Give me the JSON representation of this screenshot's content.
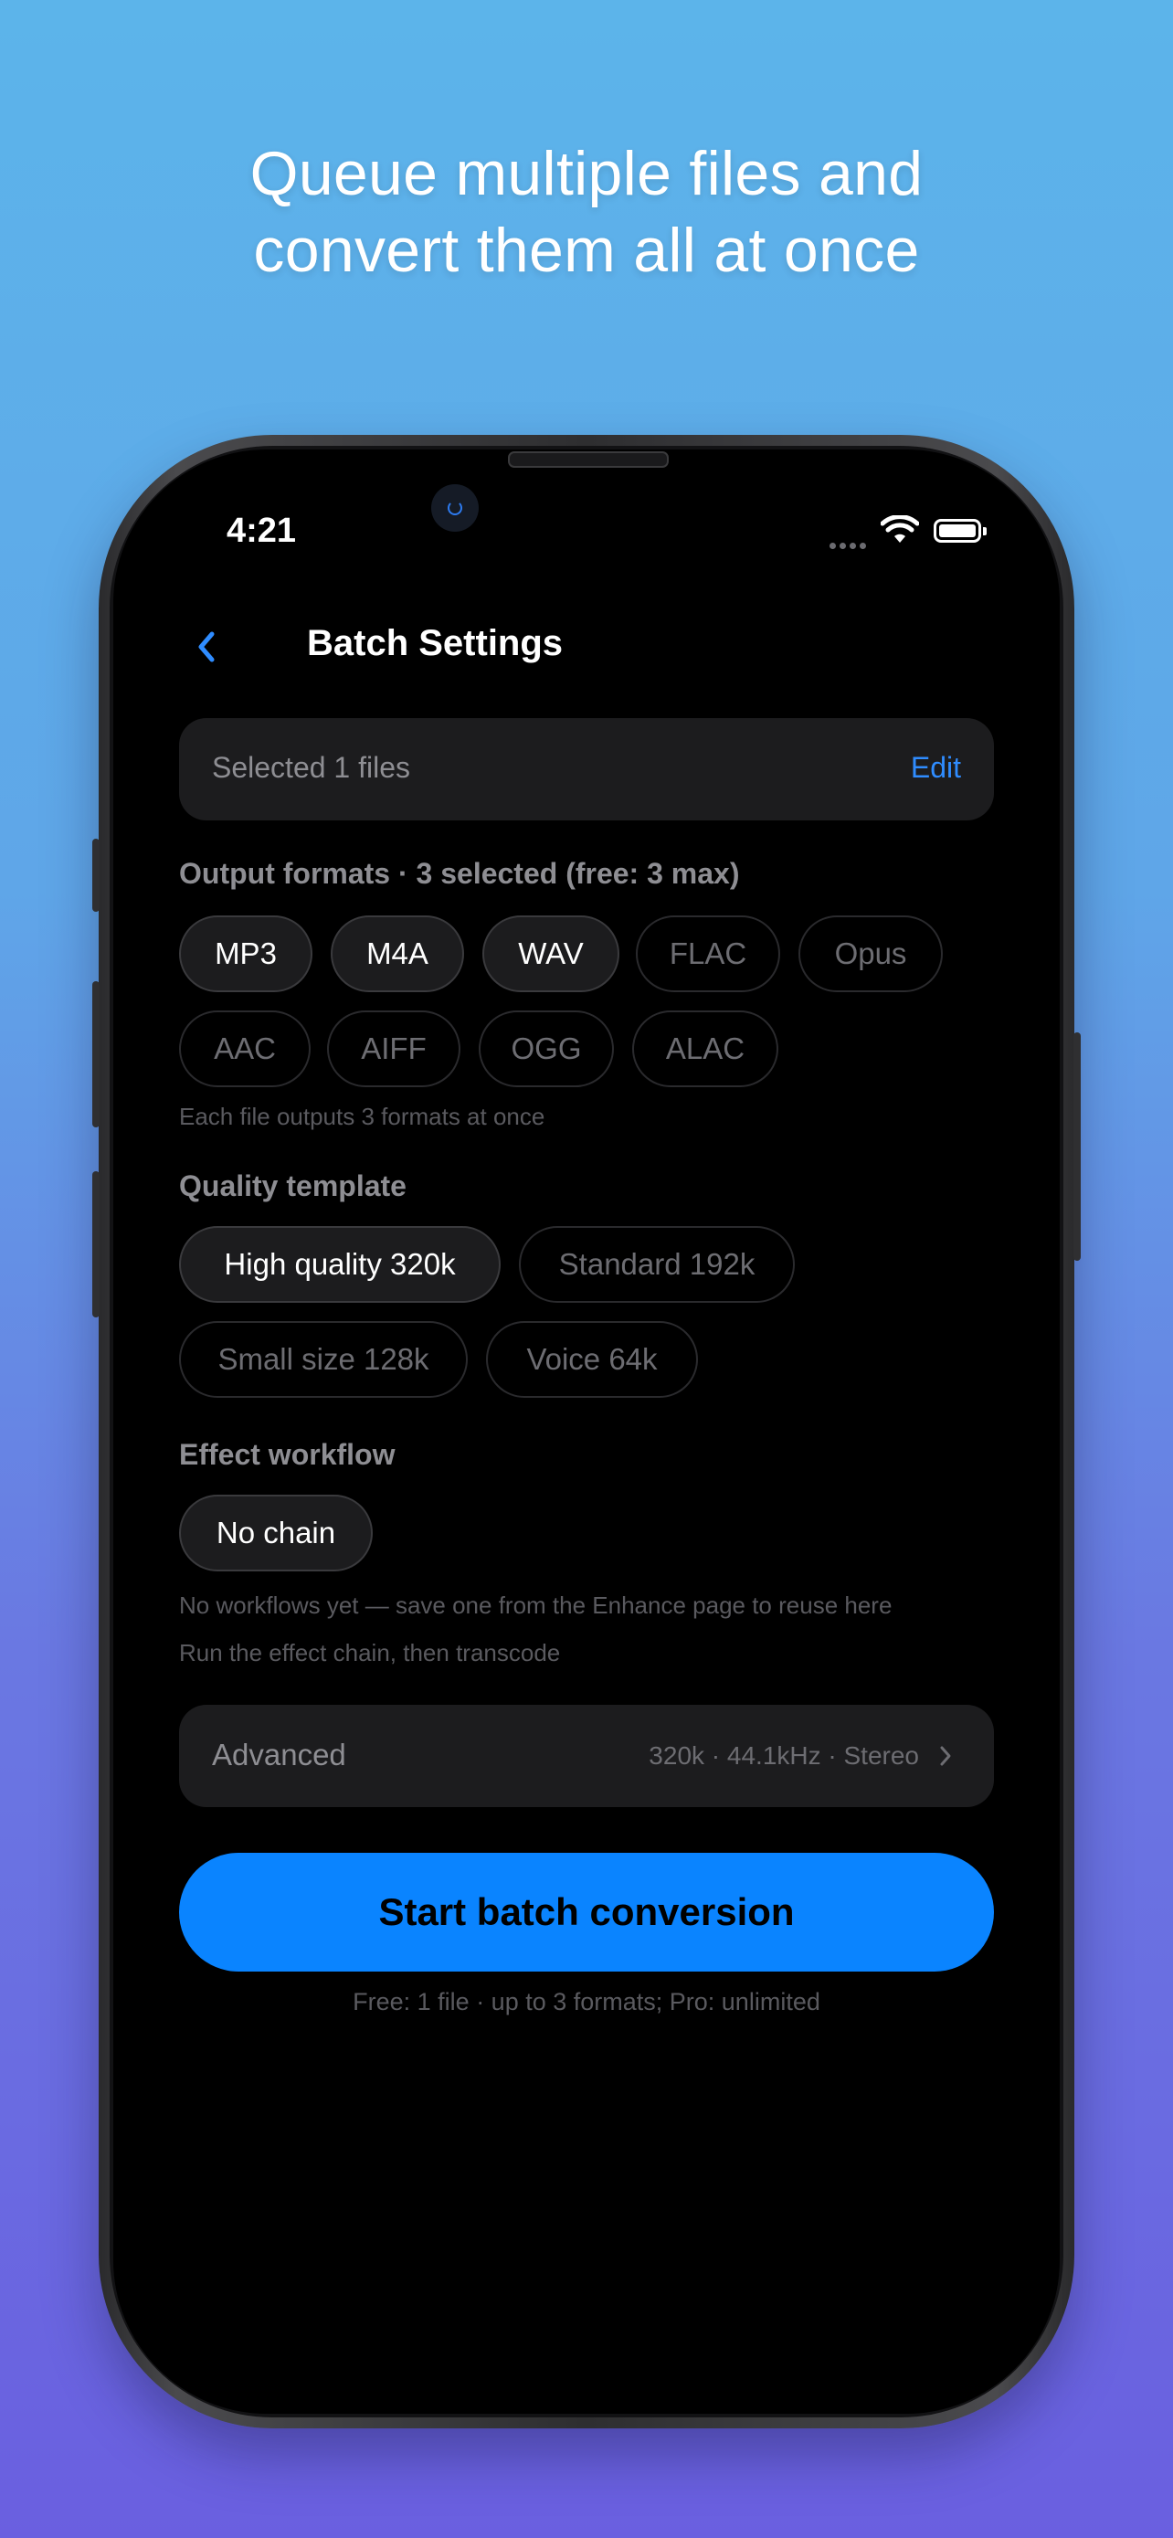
{
  "headline": {
    "line1": "Queue multiple files and",
    "line2": "convert them all at once"
  },
  "status_bar": {
    "time": "4:21"
  },
  "nav": {
    "title": "Batch Settings",
    "back_icon": "chevron-left-icon"
  },
  "files": {
    "label": "Selected 1 files",
    "edit_label": "Edit"
  },
  "output_formats": {
    "label": "Output formats · 3 selected (free: 3 max)",
    "options": [
      {
        "label": "MP3",
        "selected": true
      },
      {
        "label": "M4A",
        "selected": true
      },
      {
        "label": "WAV",
        "selected": true
      },
      {
        "label": "FLAC",
        "selected": false
      },
      {
        "label": "Opus",
        "selected": false
      },
      {
        "label": "AAC",
        "selected": false
      },
      {
        "label": "AIFF",
        "selected": false
      },
      {
        "label": "OGG",
        "selected": false
      },
      {
        "label": "ALAC",
        "selected": false
      }
    ],
    "hint": "Each file outputs 3 formats at once"
  },
  "quality_template": {
    "label": "Quality template",
    "options": [
      {
        "label": "High quality 320k",
        "selected": true
      },
      {
        "label": "Standard 192k",
        "selected": false
      },
      {
        "label": "Small size 128k",
        "selected": false
      },
      {
        "label": "Voice 64k",
        "selected": false
      }
    ]
  },
  "effect_workflow": {
    "label": "Effect workflow",
    "chip": "No chain",
    "hint1": "No workflows yet — save one from the Enhance page to reuse here",
    "hint2": "Run the effect chain, then transcode"
  },
  "advanced": {
    "label": "Advanced",
    "value": "320k · 44.1kHz · Stereo"
  },
  "start_button": {
    "label": "Start batch conversion"
  },
  "footer_note": "Free: 1 file · up to 3 formats; Pro: unlimited",
  "colors": {
    "accent": "#0a84ff",
    "link": "#2f8cff",
    "background_top": "#5cb4ea",
    "background_bottom": "#6a5fe0"
  }
}
